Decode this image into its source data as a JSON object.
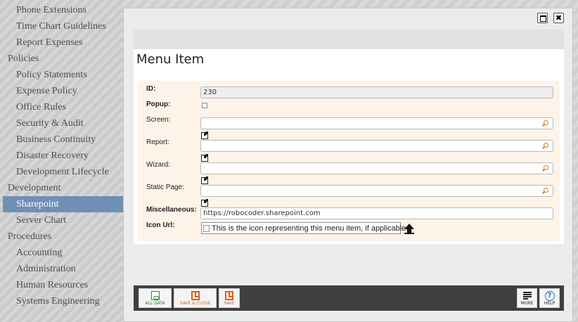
{
  "sidebar": {
    "items": [
      {
        "label": "Phone Extensions",
        "kind": "child"
      },
      {
        "label": "Time Chart Guidelines",
        "kind": "child"
      },
      {
        "label": "Report Expenses",
        "kind": "child"
      },
      {
        "label": "Policies",
        "kind": "group"
      },
      {
        "label": "Policy Statements",
        "kind": "child"
      },
      {
        "label": "Expense Policy",
        "kind": "child"
      },
      {
        "label": "Office Rules",
        "kind": "child"
      },
      {
        "label": "Security & Audit",
        "kind": "child"
      },
      {
        "label": "Business Continuity",
        "kind": "child"
      },
      {
        "label": "Disaster Recovery",
        "kind": "child"
      },
      {
        "label": "Development Lifecycle",
        "kind": "child"
      },
      {
        "label": "Development",
        "kind": "group"
      },
      {
        "label": "Sharepoint",
        "kind": "child",
        "active": true
      },
      {
        "label": "Server Chart",
        "kind": "child"
      },
      {
        "label": "Procedures",
        "kind": "group"
      },
      {
        "label": "Accounting",
        "kind": "child"
      },
      {
        "label": "Administration",
        "kind": "child"
      },
      {
        "label": "Human Resources",
        "kind": "child"
      },
      {
        "label": "Systems Engineering",
        "kind": "child"
      }
    ]
  },
  "dialog": {
    "close_glyph": "✖",
    "title": "Menu Item",
    "form": {
      "id_label": "ID:",
      "id_value": "230",
      "popup_label": "Popup:",
      "popup_checked": false,
      "screen_label": "Screen:",
      "screen_value": "",
      "report_label": "Report:",
      "report_value": "",
      "wizard_label": "Wizard:",
      "wizard_value": "",
      "static_page_label": "Static Page:",
      "static_page_value": "",
      "misc_label": "Miscellaneous:",
      "misc_value": "https://robocoder.sharepoint.com",
      "icon_url_label": "Icon Url:",
      "icon_alt_text": "This is the icon representing this menu item, if applicable."
    },
    "toolbar": {
      "all_data": "ALL DATA",
      "save_close": "SAVE & CLOSE",
      "save": "SAVE",
      "more": "MORE",
      "help": "HELP",
      "help_glyph": "?"
    }
  },
  "colors": {
    "active_nav": "#6f8fb6",
    "form_background": "#fdf3e9",
    "toolbar_background": "#3f3f3f",
    "save_accent": "#e05a17",
    "all_data_accent": "#2a7a2a",
    "help_accent": "#2f6fc4"
  }
}
